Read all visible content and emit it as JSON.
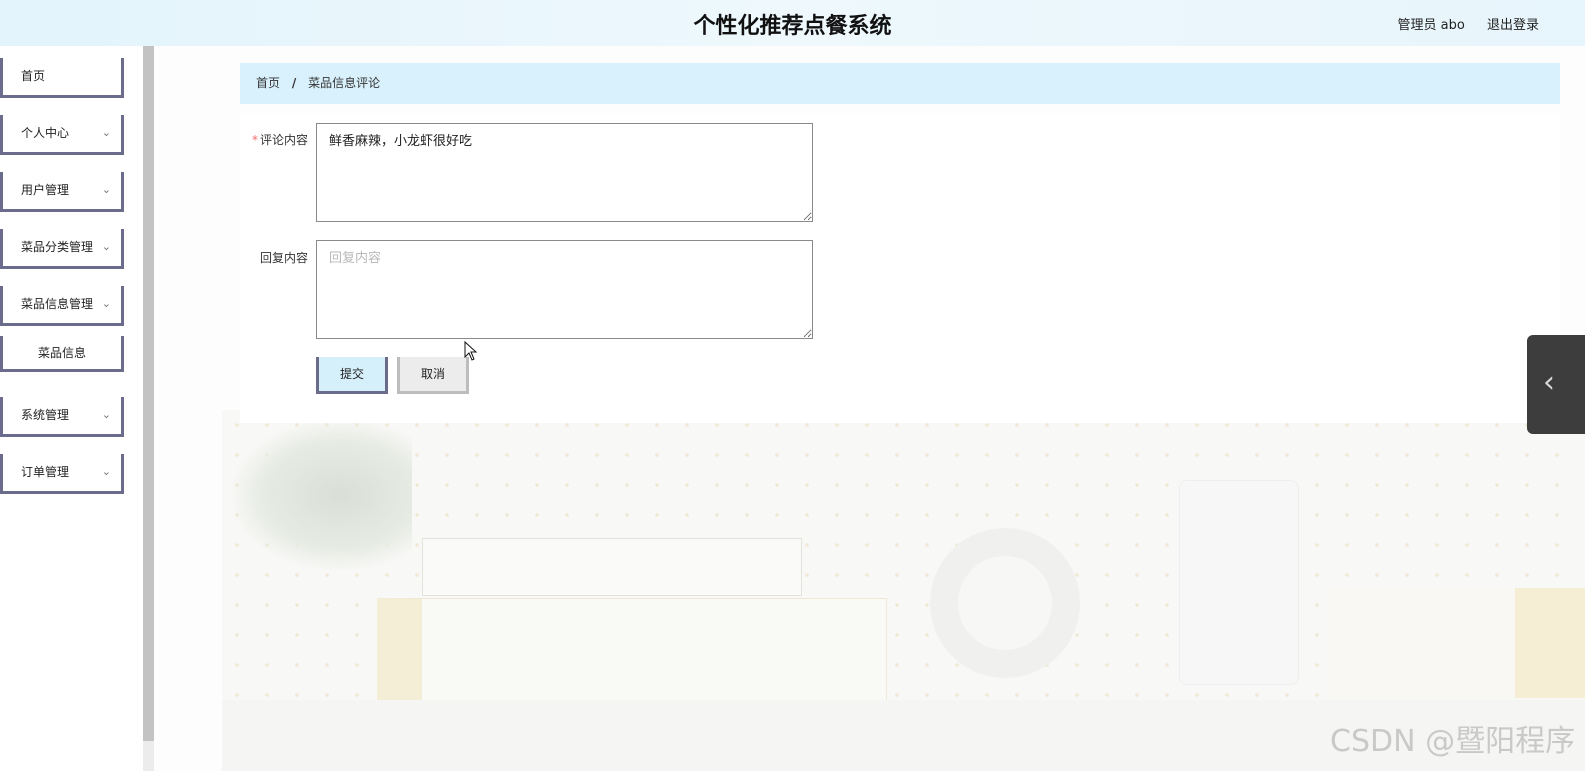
{
  "header": {
    "title": "个性化推荐点餐系统",
    "user": "管理员 abo",
    "logout": "退出登录"
  },
  "sidebar": {
    "items": [
      {
        "label": "首页",
        "has_arrow": false
      },
      {
        "label": "个人中心",
        "has_arrow": true
      },
      {
        "label": "用户管理",
        "has_arrow": true
      },
      {
        "label": "菜品分类管理",
        "has_arrow": true
      },
      {
        "label": "菜品信息管理",
        "has_arrow": true
      },
      {
        "label": "系统管理",
        "has_arrow": true
      },
      {
        "label": "订单管理",
        "has_arrow": true
      }
    ],
    "sub_item": "菜品信息",
    "arrow_icon": "chevron-down-icon"
  },
  "breadcrumb": {
    "home": "首页",
    "separator": "/",
    "current": "菜品信息评论"
  },
  "form": {
    "comment_label": "评论内容",
    "required_mark": "*",
    "comment_value": "鲜香麻辣，小龙虾很好吃",
    "reply_label": "回复内容",
    "reply_placeholder": "回复内容",
    "submit_label": "提交",
    "cancel_label": "取消"
  },
  "side_toggle": {
    "icon": "chevron-left-icon",
    "glyph": "‹"
  },
  "watermark": "CSDN @暨阳程序",
  "colors": {
    "header_bg": "#e3f4fc",
    "breadcrumb_bg": "#d9f1fc",
    "nav_border": "#6b6b8c",
    "submit_bg": "#d5effb",
    "cancel_bg": "#ececec",
    "toggle_bg": "#3d3d3d",
    "required": "#f56c6c"
  }
}
